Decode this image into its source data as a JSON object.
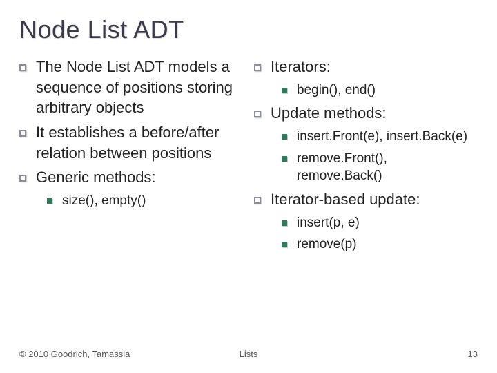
{
  "title": "Node List ADT",
  "left": {
    "items": [
      "The Node List ADT models a sequence of positions storing arbitrary objects",
      "It establishes a before/after relation between positions",
      "Generic methods:"
    ],
    "sub": [
      "size(), empty()"
    ]
  },
  "right": {
    "group1": "Iterators:",
    "group1_sub": [
      "begin(), end()"
    ],
    "group2": "Update methods:",
    "group2_sub": [
      "insert.Front(e), insert.Back(e)",
      "remove.Front(), remove.Back()"
    ],
    "group3": "Iterator-based update:",
    "group3_sub": [
      "insert(p, e)",
      "remove(p)"
    ]
  },
  "footer": {
    "copyright": "© 2010 Goodrich, Tamassia",
    "center": "Lists",
    "page": "13"
  }
}
